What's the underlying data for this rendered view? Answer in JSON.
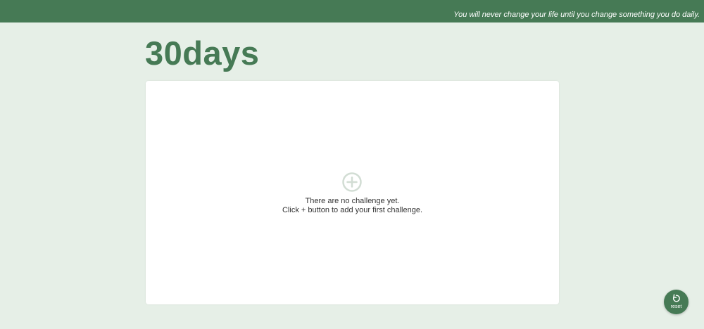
{
  "header": {
    "quote": "You will never change your life until you change something you do daily."
  },
  "app": {
    "logo": "30days"
  },
  "empty_state": {
    "icon": "plus-circle-icon",
    "line1": "There are no challenge yet.",
    "line2": "Click + button to add your first challenge."
  },
  "reset": {
    "icon": "refresh-icon",
    "label": "reset"
  },
  "colors": {
    "brand": "#467a55",
    "background": "#e6efe7",
    "card": "#ffffff",
    "icon_muted": "#d2ddd4",
    "text": "#333333"
  }
}
